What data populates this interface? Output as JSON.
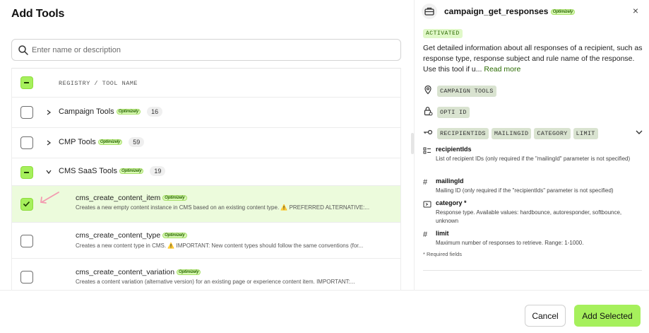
{
  "left": {
    "title": "Add Tools",
    "search_placeholder": "Enter name or description",
    "header_label": "REGISTRY / TOOL NAME",
    "groups": [
      {
        "name": "Campaign Tools",
        "badge": "Optimizely",
        "count": "16"
      },
      {
        "name": "CMP Tools",
        "badge": "Optimizely",
        "count": "59"
      },
      {
        "name": "CMS SaaS Tools",
        "badge": "Optimizely",
        "count": "19"
      }
    ],
    "tools": [
      {
        "name": "cms_create_content_item",
        "badge": "Optimizely",
        "desc": "Creates a new empty content instance in CMS based on an existing content type. ⚠️ PREFERRED ALTERNATIVE:..."
      },
      {
        "name": "cms_create_content_type",
        "badge": "Optimizely",
        "desc": "Creates a new content type in CMS. ⚠️ IMPORTANT: New content types should follow the same conventions (for..."
      },
      {
        "name": "cms_create_content_variation",
        "badge": "Optimizely",
        "desc": "Creates a content variation (alternative version) for an existing page or experience content item. IMPORTANT:..."
      }
    ]
  },
  "right": {
    "title": "campaign_get_responses",
    "title_badge": "Optimizely",
    "close": "×",
    "status": "ACTIVATED",
    "description": "Get detailed information about all responses of a recipient, such as response type, response subject and rule name of the response. Use this tool if u...",
    "read_more": "Read more",
    "registry_chip": "CAMPAIGN TOOLS",
    "auth_chip": "OPTI ID",
    "param_chips": [
      "RECIPIENTIDS",
      "MAILINGID",
      "CATEGORY",
      "LIMIT"
    ],
    "params": [
      {
        "name": "recipientIds",
        "desc": "List of recipient IDs (only required if the \"mailingId\" parameter is not specified)",
        "icon": "list-icon"
      },
      {
        "name": "mailingId",
        "desc": "Mailing ID (only required if the \"recipientIds\" parameter is not specified)",
        "icon": "hash-icon"
      },
      {
        "name": "category *",
        "desc": "Response type. Available values: hardbounce, autoresponder, softbounce, unknown",
        "icon": "enum-icon"
      },
      {
        "name": "limit",
        "desc": "Maximum number of responses to retrieve. Range: 1-1000.",
        "icon": "hash-icon"
      }
    ],
    "required_note": "* Required fields"
  },
  "footer": {
    "cancel": "Cancel",
    "add_selected": "Add Selected"
  },
  "colors": {
    "accent": "#a6f05c",
    "selected_row": "#ecfbdc",
    "link": "#2a6a00"
  }
}
